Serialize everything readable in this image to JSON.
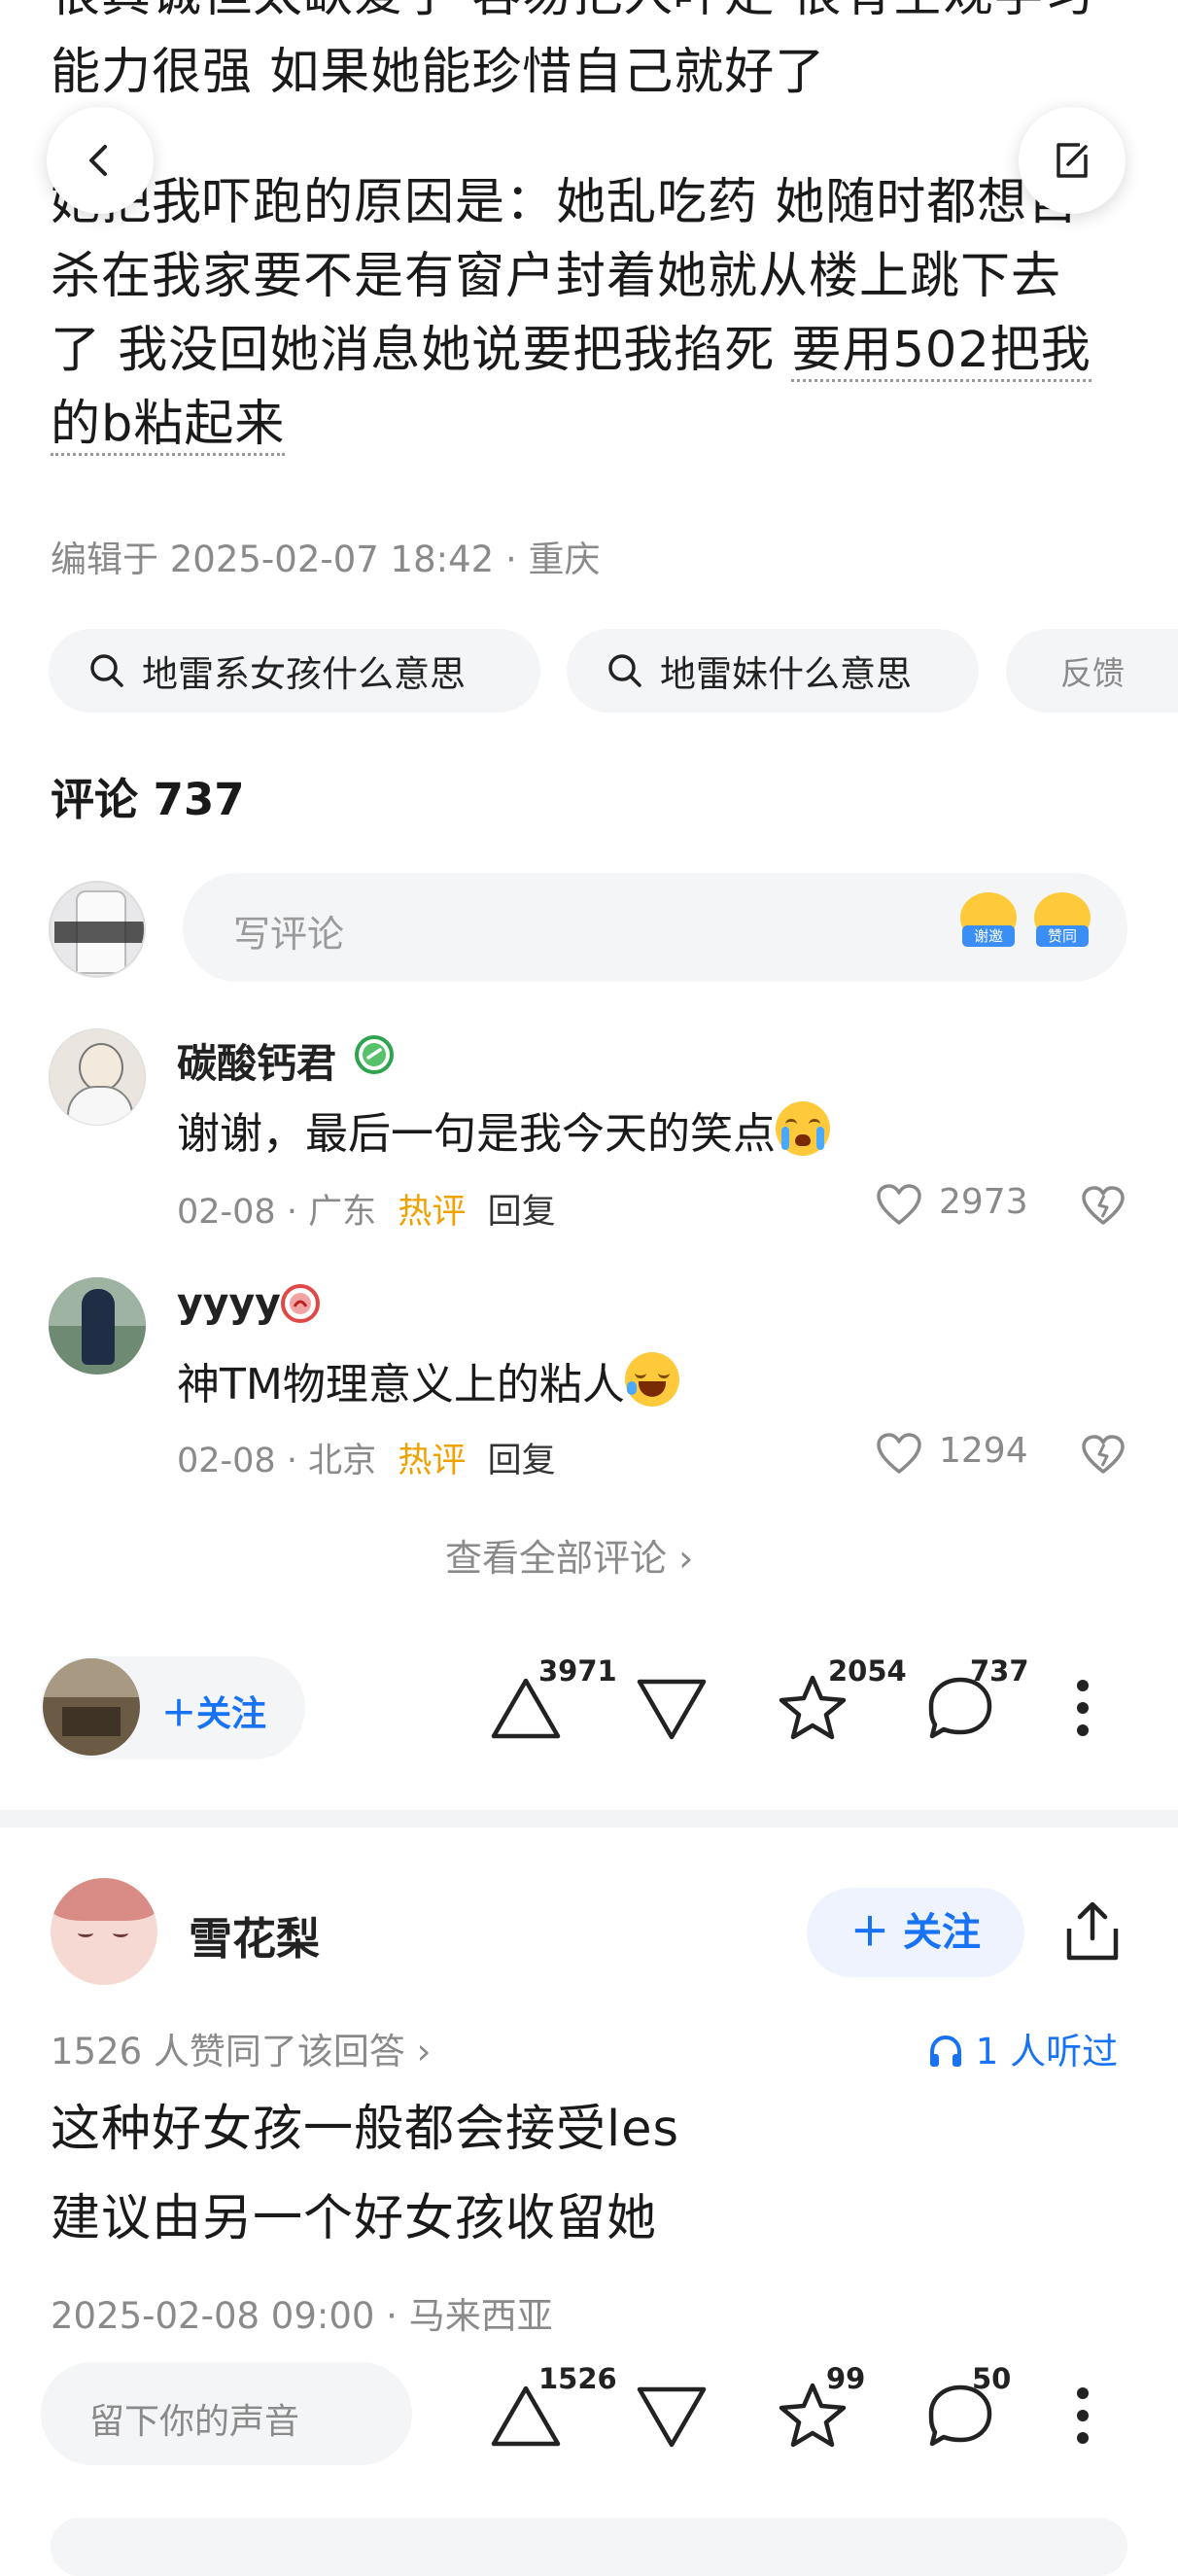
{
  "article": {
    "top_line_partial": "很真诚但太缺爱了 容易把人吓走 很有空观学习",
    "line_1": "能力很强 如果她能珍惜自己就好了",
    "para2_line1": "她把我吓跑的原因是：她乱吃药 她随时都想自",
    "para2_line2": "杀在我家要不是有窗户封着她就从楼上跳下去",
    "para2_line3a": "了 我没回她消息她说要把我掐死 ",
    "para2_line3b": "要用502把我",
    "para2_line4": "的b粘起来",
    "edited": "编辑于 2025-02-07 18:42 · 重庆"
  },
  "search_chips": [
    {
      "label": "地雷系女孩什么意思"
    },
    {
      "label": "地雷妹什么意思"
    }
  ],
  "feedback_label": "反馈",
  "comments": {
    "title": "评论 737",
    "input_placeholder": "写评论",
    "sticker_1": "谢邀",
    "sticker_2": "赞同",
    "items": [
      {
        "name": "碳酸钙君",
        "text": "谢谢，最后一句是我今天的笑点",
        "date": "02-08",
        "location": "广东",
        "hot": "热评",
        "reply": "回复",
        "likes": "2973"
      },
      {
        "name": "yyyy",
        "text": "神TM物理意义上的粘人",
        "date": "02-08",
        "location": "北京",
        "hot": "热评",
        "reply": "回复",
        "likes": "1294"
      }
    ],
    "view_all": "查看全部评论 ›"
  },
  "action_bar_1": {
    "follow": "＋关注",
    "upvotes": "3971",
    "stars": "2054",
    "comments": "737"
  },
  "answer2": {
    "author": "雪花梨",
    "follow": "＋ 关注",
    "agree": "1526 人赞同了该回答 ›",
    "listened": "1 人听过",
    "line1": "这种好女孩一般都会接受les",
    "line2": "建议由另一个好女孩收留她",
    "meta": "2025-02-08 09:00 · 马来西亚",
    "voice_placeholder": "留下你的声音",
    "upvotes": "1526",
    "stars": "99",
    "comments": "50"
  },
  "colors": {
    "accent_blue": "#1772f6",
    "hot_orange": "#f0a000",
    "chip_bg": "#f4f5f7",
    "meta_grey": "#8a8a8a"
  }
}
